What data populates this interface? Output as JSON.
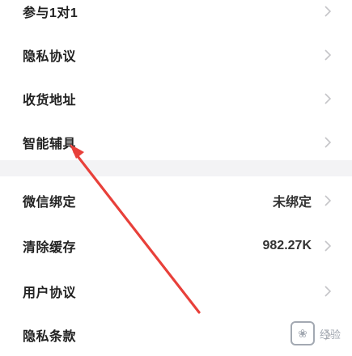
{
  "settings": {
    "group1": [
      {
        "label": "参与1对1"
      },
      {
        "label": "隐私协议"
      },
      {
        "label": "收货地址"
      },
      {
        "label": "智能辅具"
      }
    ],
    "group2": [
      {
        "label": "微信绑定",
        "value": "未绑定"
      },
      {
        "label": "清除缓存",
        "value": "982.27K"
      },
      {
        "label": "用户协议",
        "value": ""
      },
      {
        "label": "隐私条款",
        "value": ""
      }
    ]
  },
  "watermark": {
    "text": "经验"
  },
  "colors": {
    "annotation": "#e8403a",
    "divider": "#f3f3f5",
    "chevron": "#c5c5c8"
  }
}
